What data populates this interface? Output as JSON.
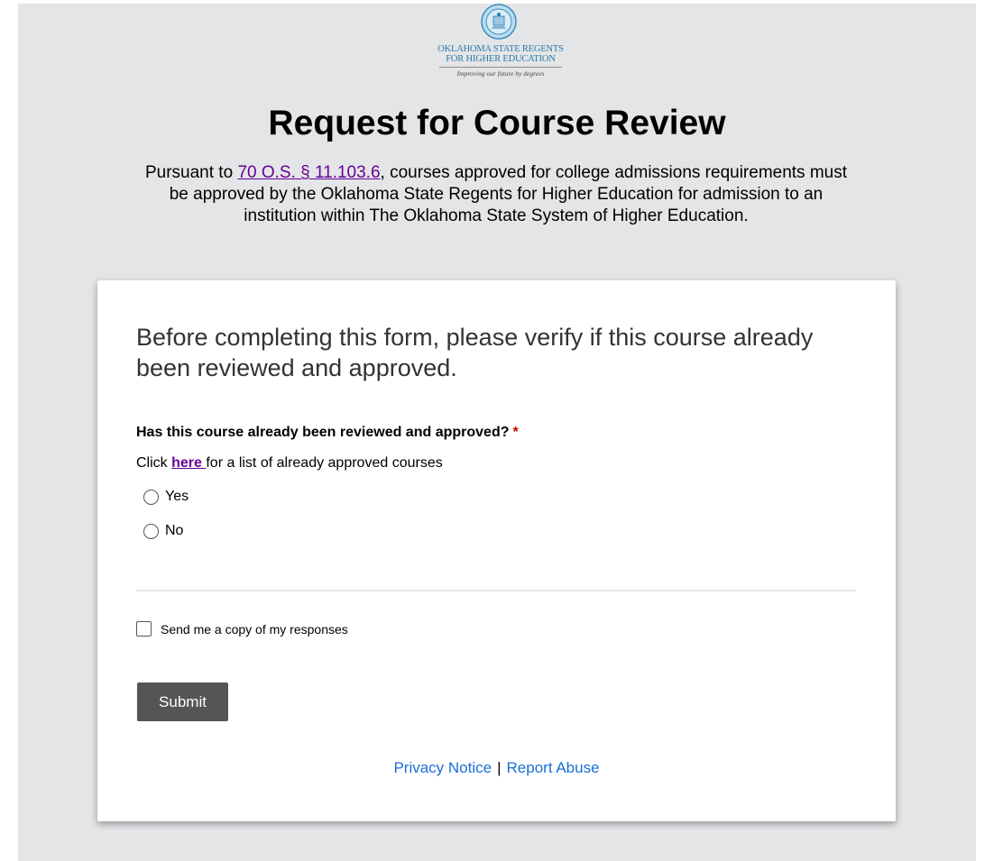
{
  "logo": {
    "line1": "OKLAHOMA STATE REGENTS",
    "line2": "FOR HIGHER EDUCATION",
    "tagline": "Improving our future by degrees"
  },
  "header": {
    "title": "Request for Course Review",
    "intro_before": "Pursuant to ",
    "intro_link": "70 O.S. § 11.103.6",
    "intro_after": ", courses approved for college admissions requirements must be approved by the Oklahoma State Regents for Higher Education for admission to an institution within The Oklahoma State System of Higher Education."
  },
  "form": {
    "heading": "Before completing this form, please verify if this course already been reviewed and approved.",
    "question": {
      "label": "Has this course already been reviewed and approved?",
      "required_mark": "*",
      "help_before": "Click ",
      "help_link": "here ",
      "help_after": "for a list of already approved courses",
      "options": [
        "Yes",
        "No"
      ]
    },
    "copy_checkbox_label": "Send me a copy of my responses",
    "submit_label": "Submit"
  },
  "footer": {
    "privacy_label": "Privacy Notice",
    "separator": "|",
    "report_label": "Report Abuse"
  },
  "colors": {
    "page_background": "#e4e5e7",
    "link_visited": "#660099",
    "footer_link": "#1a6fd6",
    "required": "#c00000",
    "submit_background": "#555555"
  }
}
